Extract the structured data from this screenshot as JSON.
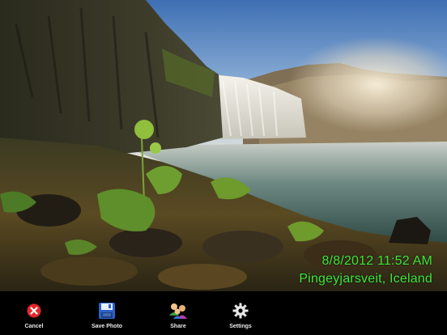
{
  "overlay": {
    "datetime": "8/8/2012 11:52 AM",
    "location": "Pingeyjarsveit, Iceland",
    "text_color": "#3ee63a"
  },
  "toolbar": {
    "items": [
      {
        "label": "Cancel",
        "icon": "cancel-icon"
      },
      {
        "label": "Save Photo",
        "icon": "floppy-disk-icon"
      },
      {
        "label": "Share",
        "icon": "people-share-icon"
      },
      {
        "label": "Settings",
        "icon": "gear-icon"
      }
    ]
  }
}
